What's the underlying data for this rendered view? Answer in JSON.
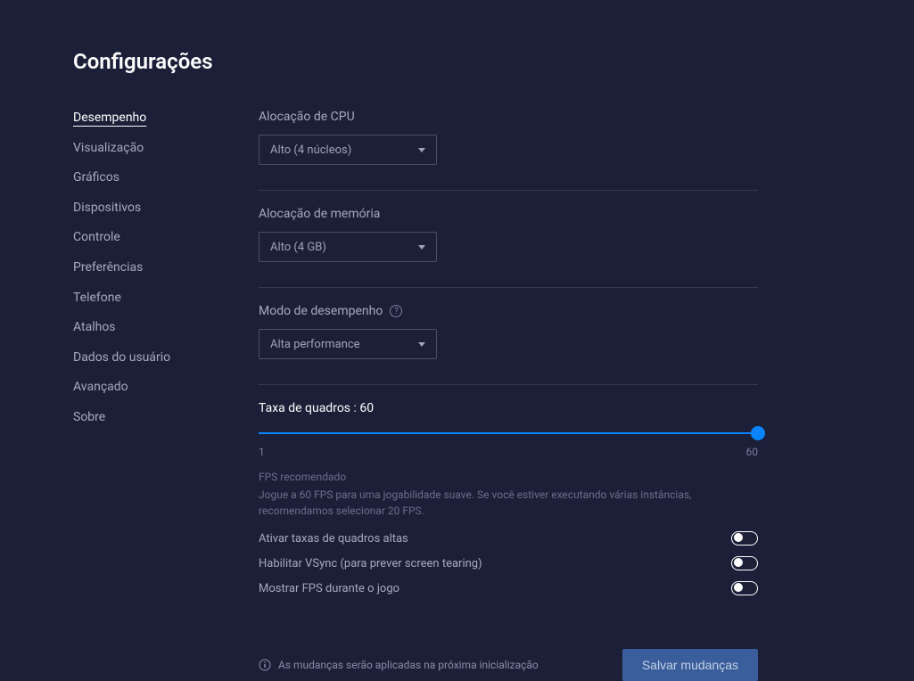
{
  "title": "Configurações",
  "sidebar": {
    "items": [
      {
        "label": "Desempenho",
        "active": true
      },
      {
        "label": "Visualização",
        "active": false
      },
      {
        "label": "Gráficos",
        "active": false
      },
      {
        "label": "Dispositivos",
        "active": false
      },
      {
        "label": "Controle",
        "active": false
      },
      {
        "label": "Preferências",
        "active": false
      },
      {
        "label": "Telefone",
        "active": false
      },
      {
        "label": "Atalhos",
        "active": false
      },
      {
        "label": "Dados do usuário",
        "active": false
      },
      {
        "label": "Avançado",
        "active": false
      },
      {
        "label": "Sobre",
        "active": false
      }
    ]
  },
  "cpu": {
    "label": "Alocação de CPU",
    "value": "Alto (4 núcleos)"
  },
  "memory": {
    "label": "Alocação de memória",
    "value": "Alto (4 GB)"
  },
  "perfmode": {
    "label": "Modo de desempenho",
    "value": "Alta performance"
  },
  "fps": {
    "label": "Taxa de quadros : 60",
    "min": "1",
    "max": "60",
    "value": 60,
    "reco_title": "FPS recomendado",
    "reco_text": "Jogue a 60 FPS para uma jogabilidade suave. Se você estiver executando várias instâncias, recomendamos selecionar 20 FPS."
  },
  "toggles": {
    "high_fps": {
      "label": "Ativar taxas de quadros altas",
      "on": false
    },
    "vsync": {
      "label": "Habilitar VSync (para prever screen tearing)",
      "on": false
    },
    "show_fps": {
      "label": "Mostrar FPS durante o jogo",
      "on": false
    }
  },
  "footer": {
    "note": "As mudanças serão aplicadas na próxima inicialização",
    "save": "Salvar mudanças"
  }
}
